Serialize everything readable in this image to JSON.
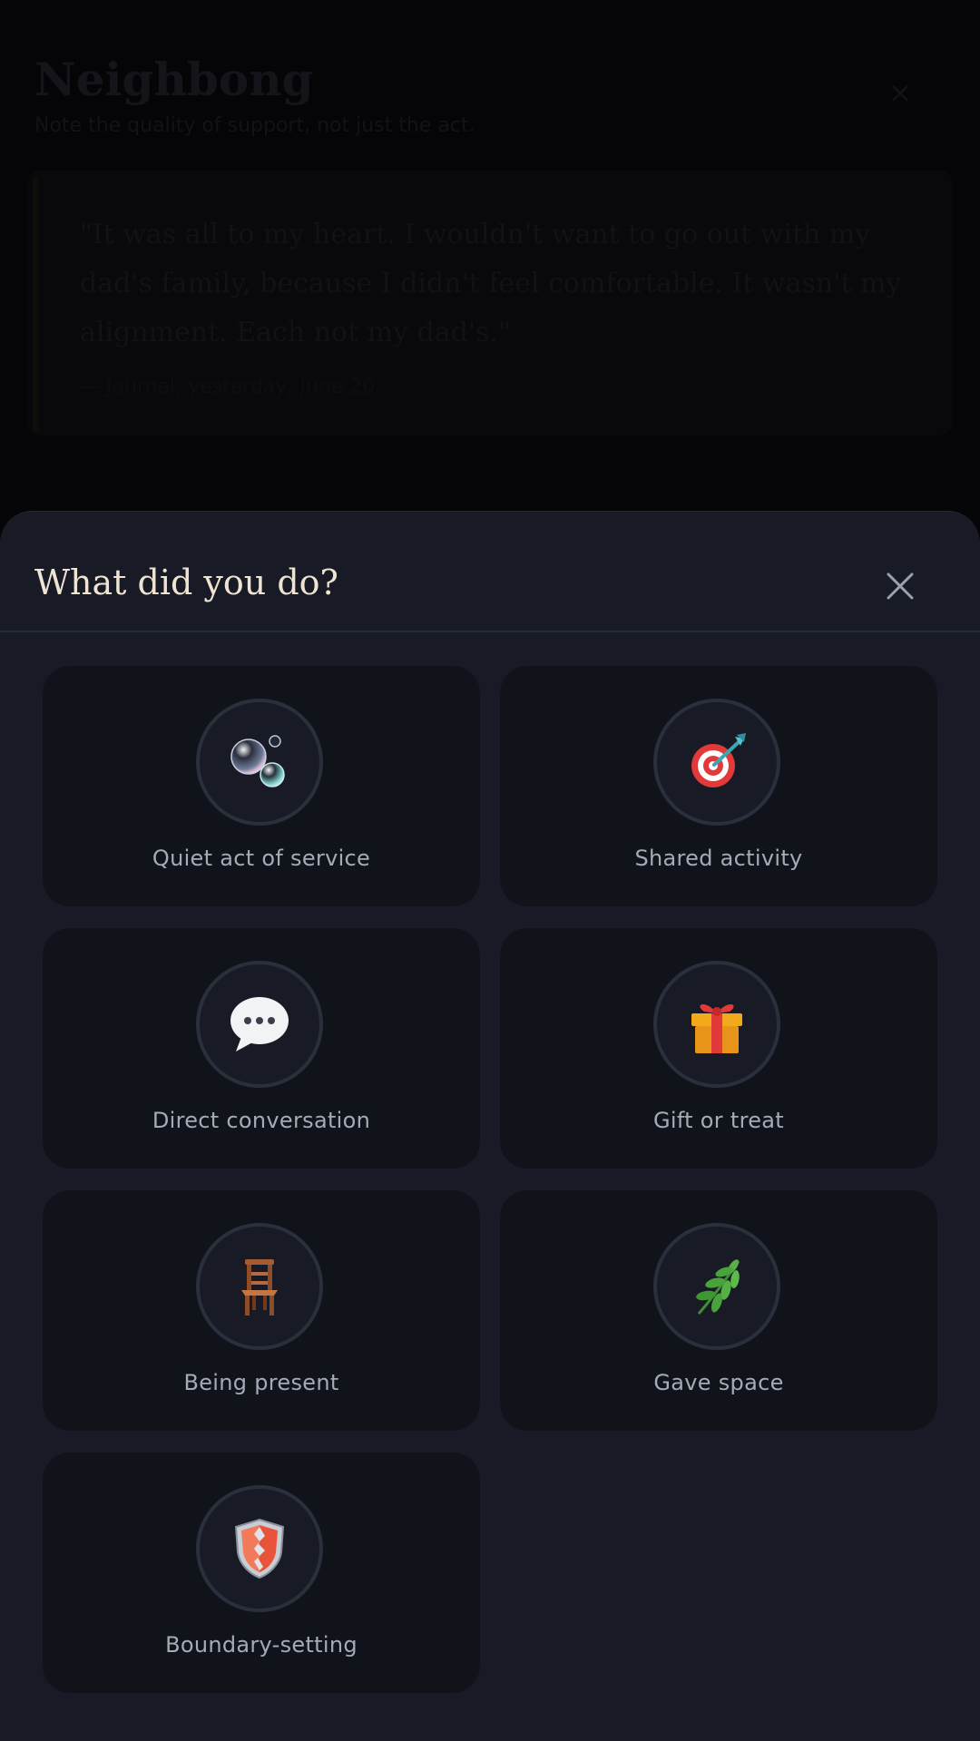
{
  "background": {
    "title": "Neighbong",
    "subtitle": "Note the quality of support, not just the act.",
    "quote": "\"It was all to my heart. I wouldn't want to go out with my dad's family, because I didn't feel comfortable. It wasn't my alignment. Each not my dad's.\"",
    "meta": "— Journal, yesterday, June 20"
  },
  "sheet": {
    "title": "What did you do?",
    "close_label": "Close"
  },
  "options": [
    {
      "label": "Quiet act of service",
      "icon": "bubbles-icon"
    },
    {
      "label": "Shared activity",
      "icon": "target-icon"
    },
    {
      "label": "Direct conversation",
      "icon": "speech-bubble-icon"
    },
    {
      "label": "Gift or treat",
      "icon": "gift-icon"
    },
    {
      "label": "Being present",
      "icon": "chair-icon"
    },
    {
      "label": "Gave space",
      "icon": "herb-icon"
    },
    {
      "label": "Boundary-setting",
      "icon": "shield-icon"
    }
  ]
}
